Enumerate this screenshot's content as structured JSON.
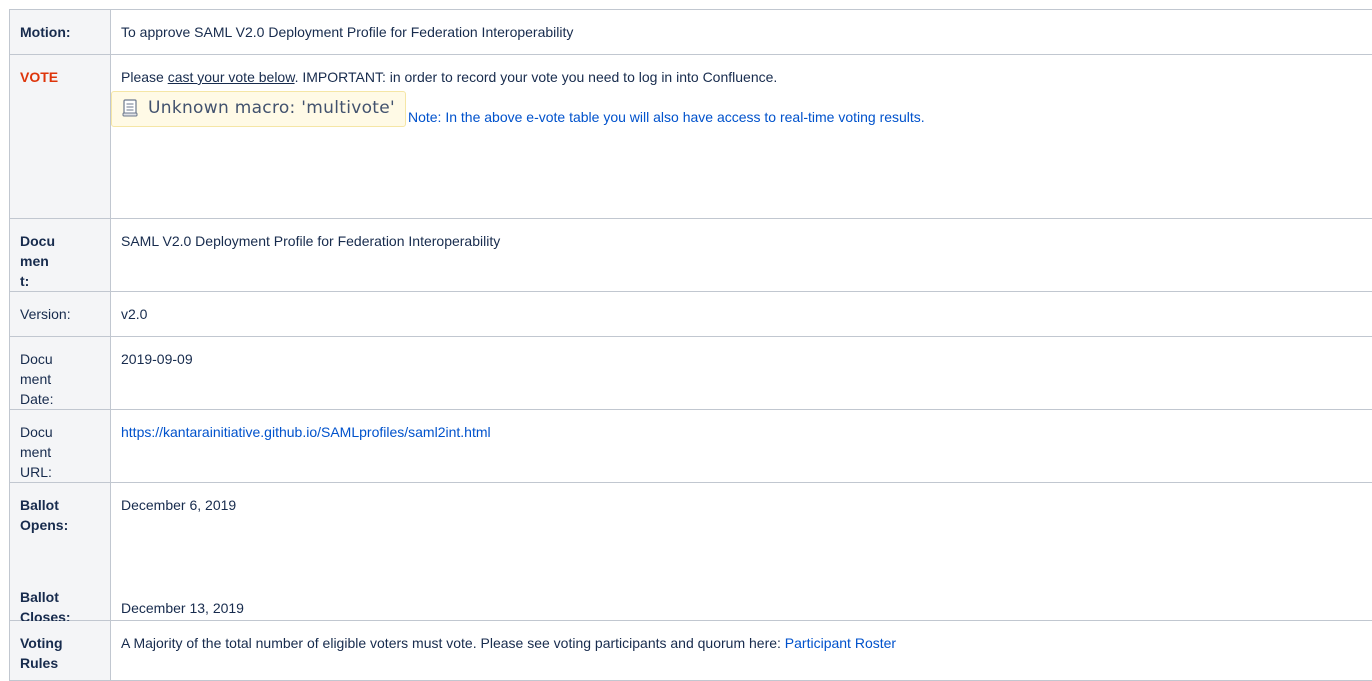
{
  "rows": {
    "motion": {
      "label": "Motion:",
      "value": "To approve SAML V2.0 Deployment Profile for Federation Interoperability"
    },
    "vote": {
      "label": "VOTE",
      "text_before": "Please ",
      "link_text": "cast your vote below",
      "text_after": ". IMPORTANT: in order to record your vote you need to log in into Confluence.",
      "macro_text": "Unknown macro: 'multivote'",
      "note": "Note: In the above e-vote table you will also have access to real-time voting results."
    },
    "document": {
      "label": "Document:",
      "value": "SAML V2.0 Deployment Profile for Federation Interoperability"
    },
    "version": {
      "label": "Version:",
      "value": "v2.0"
    },
    "document_date": {
      "label": "Document Date:",
      "value": "2019-09-09"
    },
    "document_url": {
      "label": "Document URL:",
      "value": "https://kantarainitiative.github.io/SAMLprofiles/saml2int.html"
    },
    "ballot": {
      "opens_label": "Ballot Opens:",
      "opens_value": "December 6, 2019",
      "closes_label": "Ballot Closes:",
      "closes_value": "December 13, 2019"
    },
    "voting_rules": {
      "label": "Voting Rules",
      "text": "A Majority of the total number of eligible voters must vote. Please see voting participants and quorum here: ",
      "link_text": "Participant Roster"
    }
  },
  "colors": {
    "vote_label": "#de350b",
    "link": "#0052cc",
    "header_bg": "#f4f5f7",
    "border": "#c1c7d0",
    "macro_bg": "#fffae6"
  },
  "icons": [
    "macro-scroll-icon"
  ]
}
